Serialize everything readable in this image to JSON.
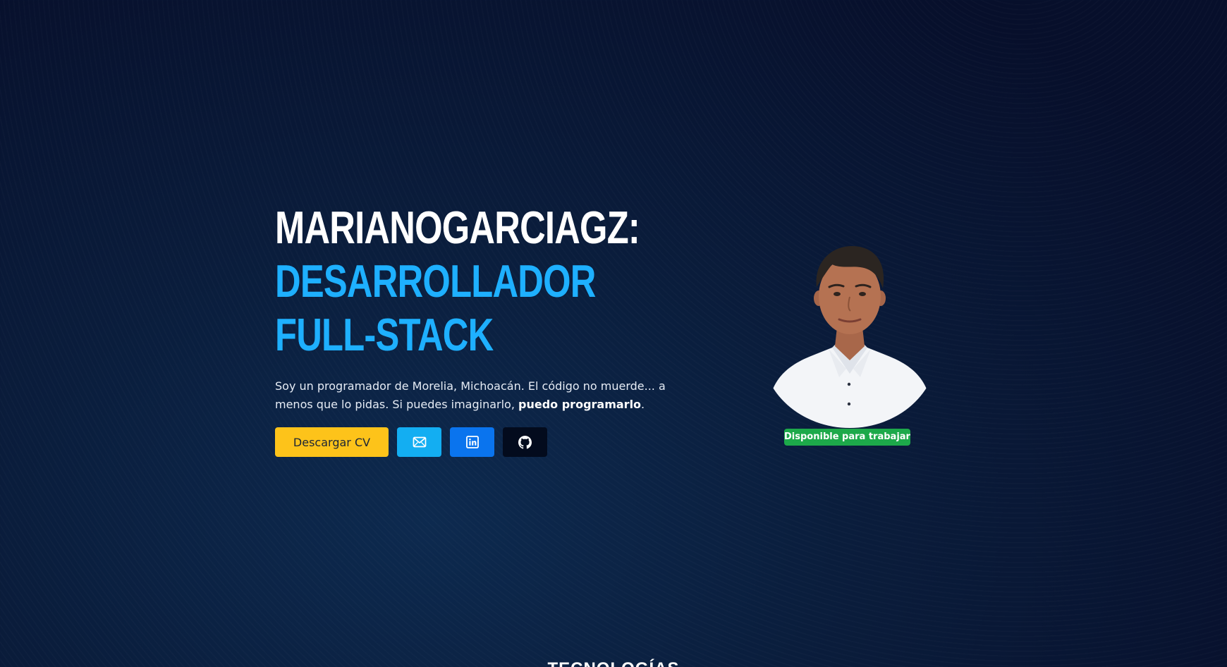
{
  "hero": {
    "title_line1": "MARIANOGARCIAGZ:",
    "title_line2": "DESARROLLADOR FULL-STACK",
    "intro_text": "Soy un programador de Morelia, Michoacán. El código no muerde... a menos que lo pidas. Si puedes imaginarlo, ",
    "intro_bold": "puedo programarlo",
    "intro_end": "."
  },
  "actions": {
    "cv_label": "Descargar CV",
    "mail_icon": "mail-icon",
    "linkedin_icon": "linkedin-icon",
    "github_icon": "github-icon"
  },
  "profile": {
    "status_badge": "Disponible para trabajar"
  },
  "next_section": {
    "title": "TECNOLOGÍAS"
  },
  "colors": {
    "background": "#070f2b",
    "accent_blue": "#1eb0ff",
    "cv_button": "#fdc31a",
    "mail_button": "#13aef2",
    "linkedin_button": "#0a74ee",
    "github_button": "#030b1d",
    "status_green": "#1da94a"
  }
}
